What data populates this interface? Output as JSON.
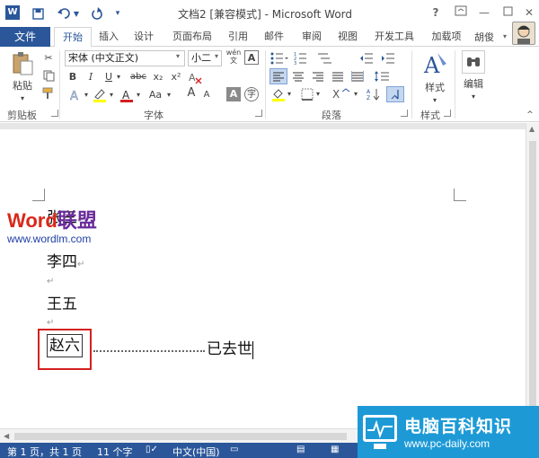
{
  "titlebar": {
    "app_icon": "W",
    "title": "文档2 [兼容模式] - Microsoft Word",
    "help": "?",
    "window_controls": [
      "restore-ribbon-icon",
      "minimize-icon",
      "maximize-icon",
      "close-icon"
    ]
  },
  "tabs": {
    "file": "文件",
    "items": [
      "开始",
      "插入",
      "设计",
      "页面布局",
      "引用",
      "邮件",
      "审阅",
      "视图",
      "开发工具",
      "加载项"
    ],
    "active": "开始",
    "user": "胡俊"
  },
  "ribbon": {
    "clipboard": {
      "paste": "粘贴",
      "label": "剪贴板"
    },
    "font": {
      "name": "宋体 (中文正文)",
      "size": "小二",
      "wen": "wén",
      "label": "字体",
      "buttons": [
        "B",
        "I",
        "U",
        "abc",
        "x₂",
        "x²",
        "A",
        "A",
        "Aa",
        "A",
        "A",
        "A",
        "A",
        "字"
      ]
    },
    "paragraph": {
      "label": "段落"
    },
    "styles": {
      "button": "样式",
      "label": "样式"
    },
    "editing": {
      "button": "编辑"
    }
  },
  "document": {
    "lines": [
      {
        "text": "张三",
        "mark": "↵"
      },
      {
        "text": "李四",
        "mark": "↵"
      },
      {
        "text": "王五",
        "mark": ""
      },
      {
        "text": "赵六",
        "mark": ""
      }
    ],
    "leader_text": "已去世",
    "watermark": {
      "word": "Word",
      "cn": "联盟",
      "url": "www.wordlm.com"
    }
  },
  "statusbar": {
    "page": "第 1 页，共 1 页",
    "words": "11 个字",
    "language": "中文(中国)"
  },
  "brand": {
    "cn": "电脑百科知识",
    "url": "www.pc-daily.com"
  },
  "colors": {
    "accent": "#2b579a",
    "highlight_box": "#d42020",
    "brand_blue": "#1d9ad6",
    "wordlm_red": "#d9281a",
    "wordlm_purple": "#6a2b9b"
  }
}
